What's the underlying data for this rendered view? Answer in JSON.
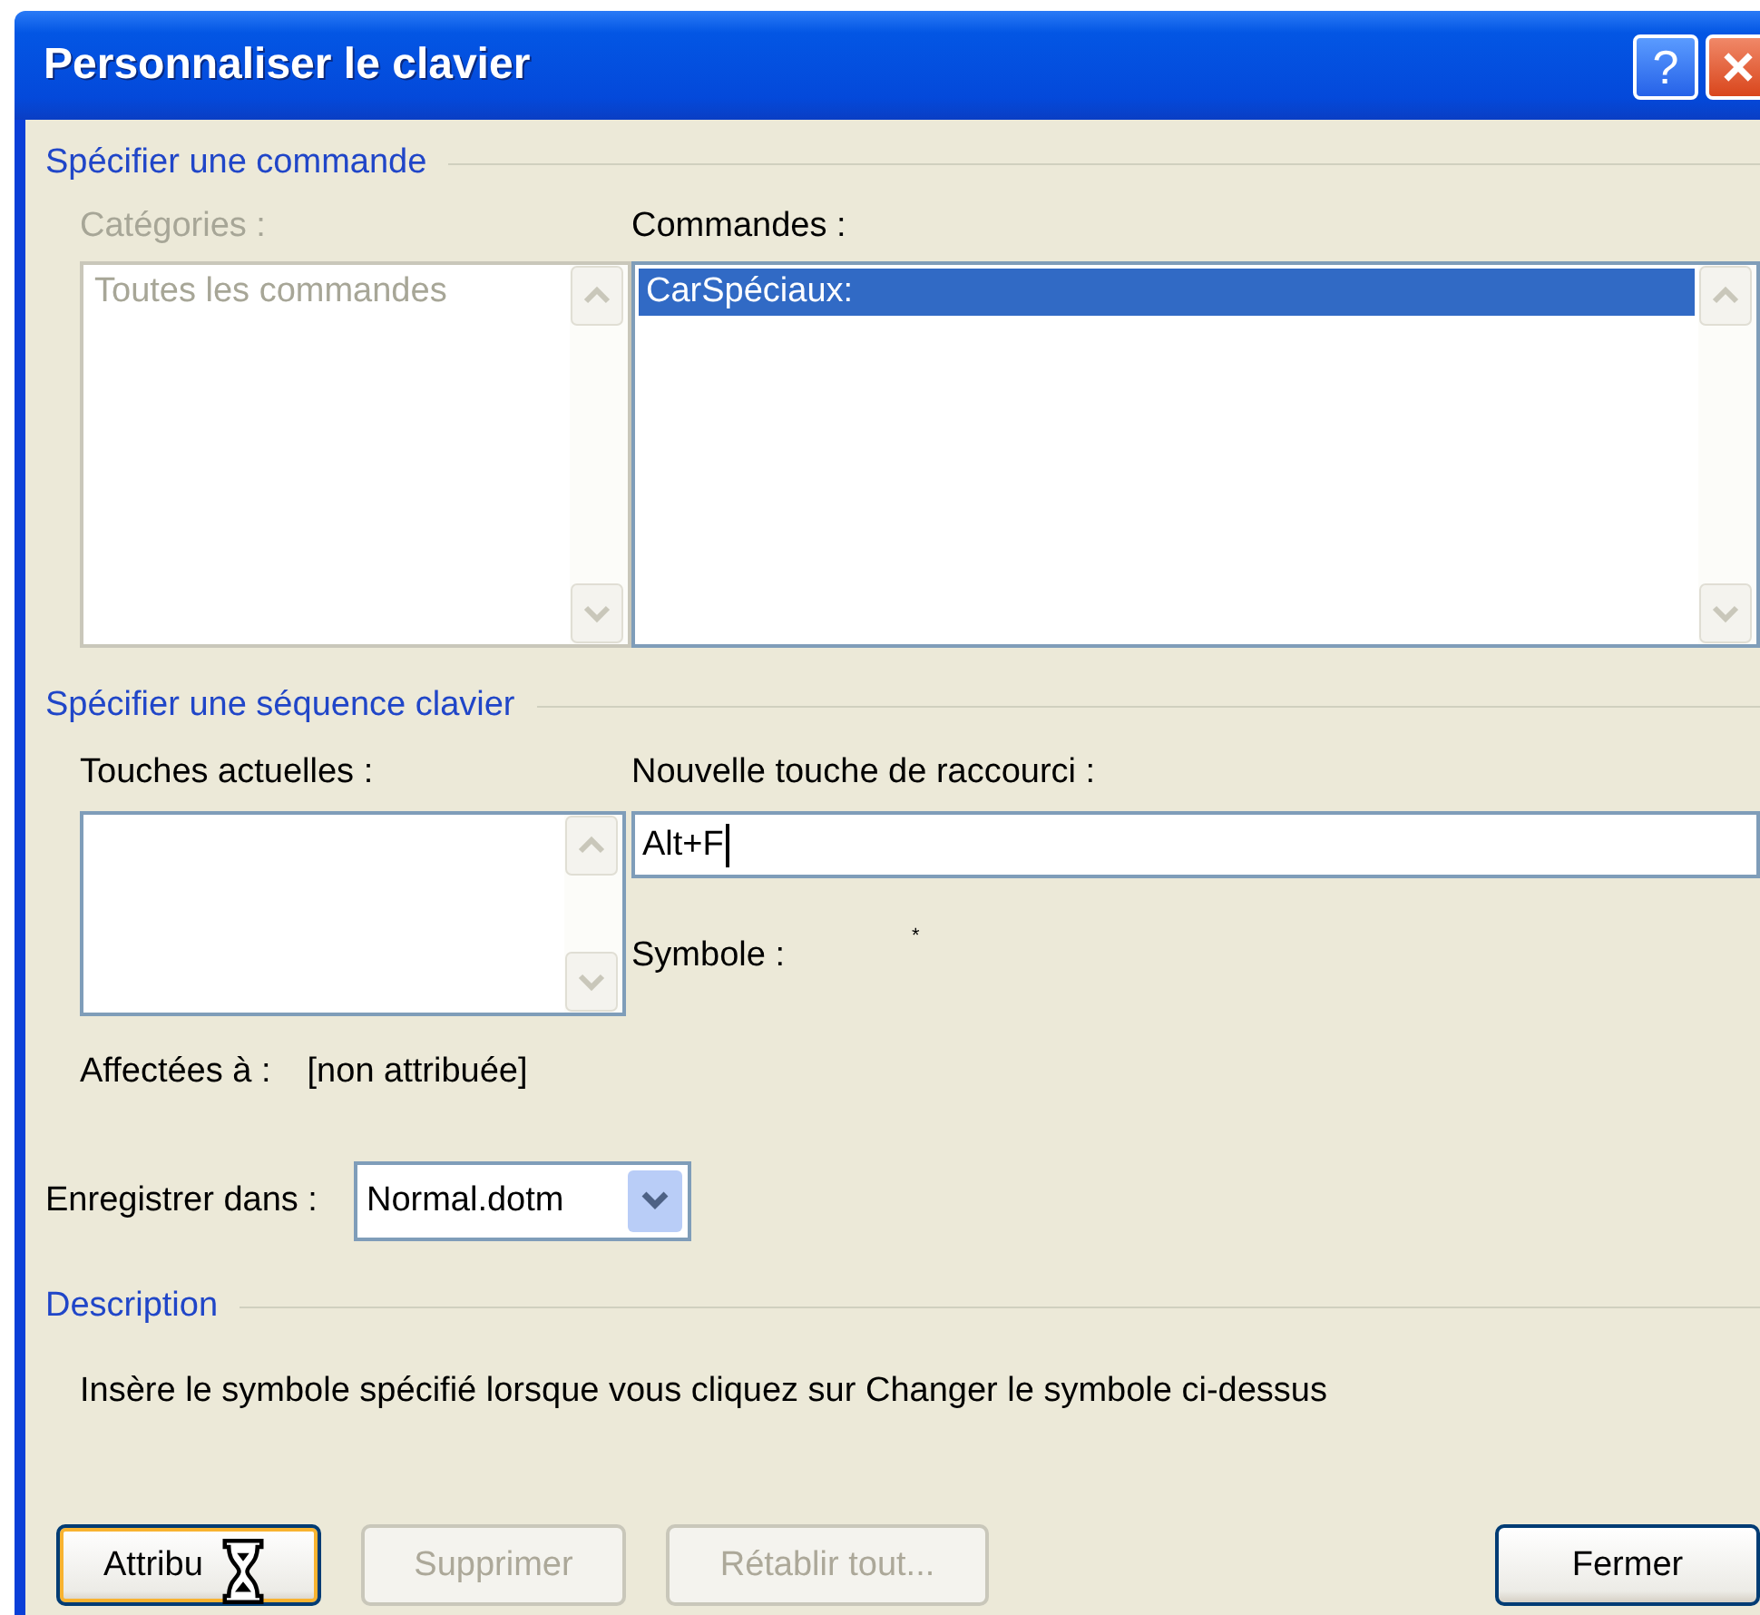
{
  "window": {
    "title": "Personnaliser le clavier",
    "controls": [
      {
        "kind": "help",
        "label": "?"
      },
      {
        "kind": "close"
      }
    ]
  },
  "command_section": {
    "title": "Spécifier une commande",
    "categories": {
      "label": "Catégories :",
      "disabled": true,
      "items": [
        {
          "label": "Toutes les commandes",
          "selected": false
        }
      ]
    },
    "commands": {
      "label": "Commandes :",
      "disabled": false,
      "items": [
        {
          "label": "CarSpéciaux:",
          "selected": true
        }
      ]
    }
  },
  "keyboard_section": {
    "title": "Spécifier une séquence clavier",
    "current_keys": {
      "label": "Touches actuelles :"
    },
    "new_shortcut": {
      "label": "Nouvelle touche de raccourci :",
      "value": "Alt+F"
    },
    "symbol": {
      "label": "Symbole :",
      "value": "*"
    },
    "assigned": {
      "label": "Affectées à :",
      "value": "[non attribuée]"
    }
  },
  "save_in": {
    "label": "Enregistrer dans :",
    "value": "Normal.dotm"
  },
  "description": {
    "title": "Description",
    "text": "Insère le symbole spécifié lorsque vous cliquez sur Changer le symbole ci-dessus"
  },
  "buttons": [
    {
      "label": "Attribu",
      "disabled": false,
      "default": true,
      "busy_cursor": true
    },
    {
      "label": "Supprimer",
      "disabled": true,
      "default": false
    },
    {
      "label": "Rétablir tout...",
      "disabled": true,
      "default": false
    },
    {
      "label": "Fermer",
      "disabled": false,
      "default": false
    }
  ]
}
